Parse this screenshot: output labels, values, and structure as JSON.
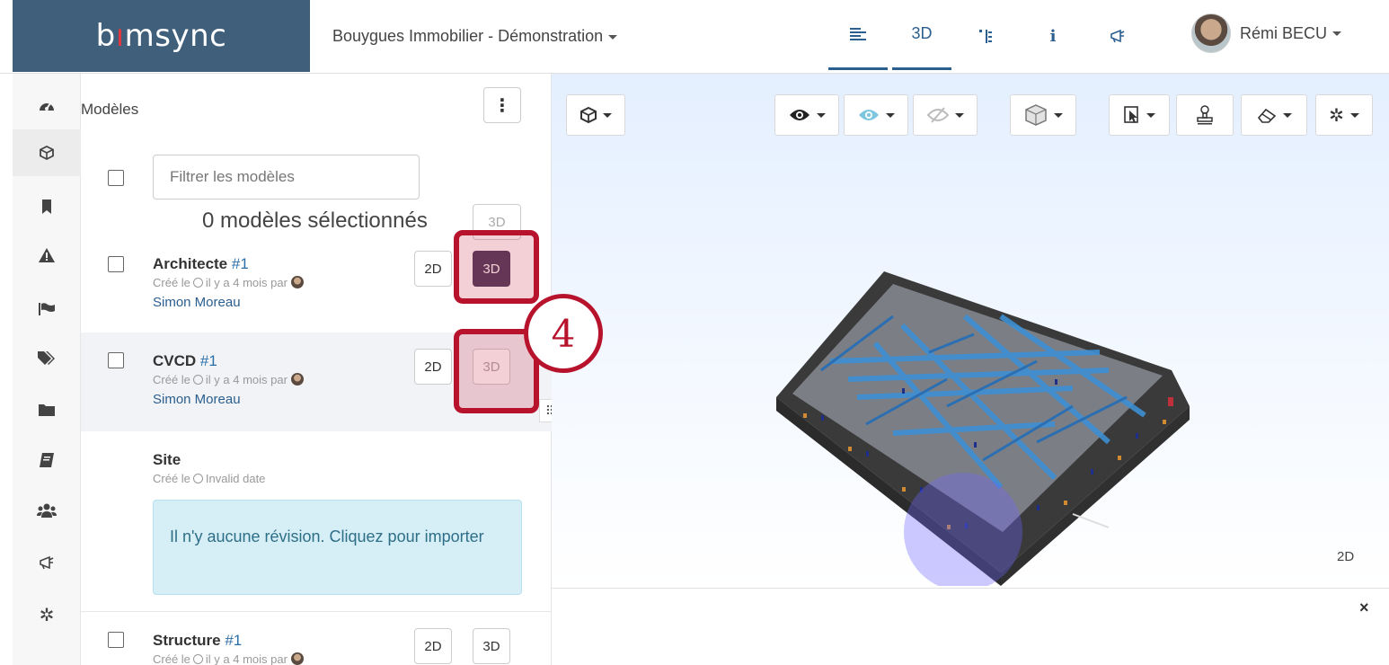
{
  "header": {
    "logo": {
      "pre": "b",
      "accent": "ı",
      "post": "msync"
    },
    "project": "Bouygues Immobilier - Démonstration",
    "tabs": [
      {
        "label": "≡",
        "icon": "list-icon"
      },
      {
        "label": "3D",
        "icon": "3d-view"
      },
      {
        "label": "⠿",
        "icon": "tree-icon"
      },
      {
        "label": "i",
        "icon": "info-icon"
      },
      {
        "label": "◁",
        "icon": "megaphone-icon"
      }
    ],
    "user": "Rémi BECU"
  },
  "sidebar": {
    "icons": [
      "dashboard-icon",
      "cube-icon",
      "bookmark-icon",
      "warning-icon",
      "flag-icon",
      "tags-icon",
      "folder-icon",
      "book-icon",
      "users-icon",
      "megaphone-icon",
      "gear-icon"
    ]
  },
  "panel": {
    "title": "Modèles",
    "filter_placeholder": "Filtrer les modèles",
    "selected_count": "0 modèles sélectionnés",
    "btn_2d": "2D",
    "btn_3d": "3D",
    "created_prefix": "Créé le",
    "models": [
      {
        "name": "Architecte",
        "rev": "#1",
        "meta": "il y a 4 mois par",
        "author": "Simon Moreau"
      },
      {
        "name": "CVCD",
        "rev": "#1",
        "meta": "il y a 4 mois par",
        "author": "Simon Moreau"
      },
      {
        "name": "Site",
        "rev": "",
        "meta": "Invalid date",
        "author": ""
      },
      {
        "name": "Structure",
        "rev": "#1",
        "meta": "il y a 4 mois par",
        "author": ""
      }
    ],
    "no_revision": "Il n'y aucune révision. Cliquez pour importer"
  },
  "viewer": {
    "label_2d": "2D",
    "close": "×",
    "toolbar": [
      "cube-menu",
      "visibility-menu",
      "xray-menu",
      "hidden-menu",
      "section-box-menu",
      "select-menu",
      "measure-tool",
      "paint-menu",
      "settings-menu"
    ]
  },
  "annotation": {
    "step": "4"
  }
}
